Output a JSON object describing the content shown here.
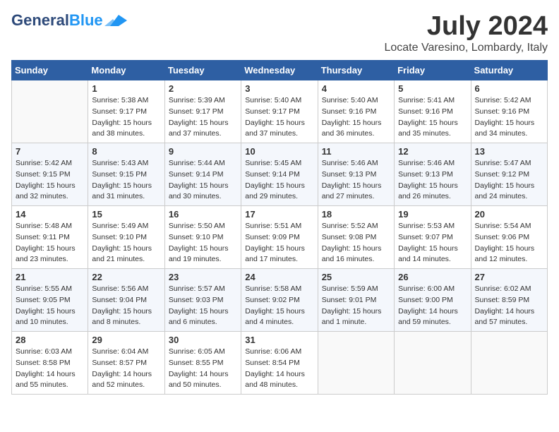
{
  "header": {
    "logo_general": "General",
    "logo_blue": "Blue",
    "month": "July 2024",
    "location": "Locate Varesino, Lombardy, Italy"
  },
  "weekdays": [
    "Sunday",
    "Monday",
    "Tuesday",
    "Wednesday",
    "Thursday",
    "Friday",
    "Saturday"
  ],
  "weeks": [
    [
      {
        "day": "",
        "sunrise": "",
        "sunset": "",
        "daylight": ""
      },
      {
        "day": "1",
        "sunrise": "Sunrise: 5:38 AM",
        "sunset": "Sunset: 9:17 PM",
        "daylight": "Daylight: 15 hours and 38 minutes."
      },
      {
        "day": "2",
        "sunrise": "Sunrise: 5:39 AM",
        "sunset": "Sunset: 9:17 PM",
        "daylight": "Daylight: 15 hours and 37 minutes."
      },
      {
        "day": "3",
        "sunrise": "Sunrise: 5:40 AM",
        "sunset": "Sunset: 9:17 PM",
        "daylight": "Daylight: 15 hours and 37 minutes."
      },
      {
        "day": "4",
        "sunrise": "Sunrise: 5:40 AM",
        "sunset": "Sunset: 9:16 PM",
        "daylight": "Daylight: 15 hours and 36 minutes."
      },
      {
        "day": "5",
        "sunrise": "Sunrise: 5:41 AM",
        "sunset": "Sunset: 9:16 PM",
        "daylight": "Daylight: 15 hours and 35 minutes."
      },
      {
        "day": "6",
        "sunrise": "Sunrise: 5:42 AM",
        "sunset": "Sunset: 9:16 PM",
        "daylight": "Daylight: 15 hours and 34 minutes."
      }
    ],
    [
      {
        "day": "7",
        "sunrise": "Sunrise: 5:42 AM",
        "sunset": "Sunset: 9:15 PM",
        "daylight": "Daylight: 15 hours and 32 minutes."
      },
      {
        "day": "8",
        "sunrise": "Sunrise: 5:43 AM",
        "sunset": "Sunset: 9:15 PM",
        "daylight": "Daylight: 15 hours and 31 minutes."
      },
      {
        "day": "9",
        "sunrise": "Sunrise: 5:44 AM",
        "sunset": "Sunset: 9:14 PM",
        "daylight": "Daylight: 15 hours and 30 minutes."
      },
      {
        "day": "10",
        "sunrise": "Sunrise: 5:45 AM",
        "sunset": "Sunset: 9:14 PM",
        "daylight": "Daylight: 15 hours and 29 minutes."
      },
      {
        "day": "11",
        "sunrise": "Sunrise: 5:46 AM",
        "sunset": "Sunset: 9:13 PM",
        "daylight": "Daylight: 15 hours and 27 minutes."
      },
      {
        "day": "12",
        "sunrise": "Sunrise: 5:46 AM",
        "sunset": "Sunset: 9:13 PM",
        "daylight": "Daylight: 15 hours and 26 minutes."
      },
      {
        "day": "13",
        "sunrise": "Sunrise: 5:47 AM",
        "sunset": "Sunset: 9:12 PM",
        "daylight": "Daylight: 15 hours and 24 minutes."
      }
    ],
    [
      {
        "day": "14",
        "sunrise": "Sunrise: 5:48 AM",
        "sunset": "Sunset: 9:11 PM",
        "daylight": "Daylight: 15 hours and 23 minutes."
      },
      {
        "day": "15",
        "sunrise": "Sunrise: 5:49 AM",
        "sunset": "Sunset: 9:10 PM",
        "daylight": "Daylight: 15 hours and 21 minutes."
      },
      {
        "day": "16",
        "sunrise": "Sunrise: 5:50 AM",
        "sunset": "Sunset: 9:10 PM",
        "daylight": "Daylight: 15 hours and 19 minutes."
      },
      {
        "day": "17",
        "sunrise": "Sunrise: 5:51 AM",
        "sunset": "Sunset: 9:09 PM",
        "daylight": "Daylight: 15 hours and 17 minutes."
      },
      {
        "day": "18",
        "sunrise": "Sunrise: 5:52 AM",
        "sunset": "Sunset: 9:08 PM",
        "daylight": "Daylight: 15 hours and 16 minutes."
      },
      {
        "day": "19",
        "sunrise": "Sunrise: 5:53 AM",
        "sunset": "Sunset: 9:07 PM",
        "daylight": "Daylight: 15 hours and 14 minutes."
      },
      {
        "day": "20",
        "sunrise": "Sunrise: 5:54 AM",
        "sunset": "Sunset: 9:06 PM",
        "daylight": "Daylight: 15 hours and 12 minutes."
      }
    ],
    [
      {
        "day": "21",
        "sunrise": "Sunrise: 5:55 AM",
        "sunset": "Sunset: 9:05 PM",
        "daylight": "Daylight: 15 hours and 10 minutes."
      },
      {
        "day": "22",
        "sunrise": "Sunrise: 5:56 AM",
        "sunset": "Sunset: 9:04 PM",
        "daylight": "Daylight: 15 hours and 8 minutes."
      },
      {
        "day": "23",
        "sunrise": "Sunrise: 5:57 AM",
        "sunset": "Sunset: 9:03 PM",
        "daylight": "Daylight: 15 hours and 6 minutes."
      },
      {
        "day": "24",
        "sunrise": "Sunrise: 5:58 AM",
        "sunset": "Sunset: 9:02 PM",
        "daylight": "Daylight: 15 hours and 4 minutes."
      },
      {
        "day": "25",
        "sunrise": "Sunrise: 5:59 AM",
        "sunset": "Sunset: 9:01 PM",
        "daylight": "Daylight: 15 hours and 1 minute."
      },
      {
        "day": "26",
        "sunrise": "Sunrise: 6:00 AM",
        "sunset": "Sunset: 9:00 PM",
        "daylight": "Daylight: 14 hours and 59 minutes."
      },
      {
        "day": "27",
        "sunrise": "Sunrise: 6:02 AM",
        "sunset": "Sunset: 8:59 PM",
        "daylight": "Daylight: 14 hours and 57 minutes."
      }
    ],
    [
      {
        "day": "28",
        "sunrise": "Sunrise: 6:03 AM",
        "sunset": "Sunset: 8:58 PM",
        "daylight": "Daylight: 14 hours and 55 minutes."
      },
      {
        "day": "29",
        "sunrise": "Sunrise: 6:04 AM",
        "sunset": "Sunset: 8:57 PM",
        "daylight": "Daylight: 14 hours and 52 minutes."
      },
      {
        "day": "30",
        "sunrise": "Sunrise: 6:05 AM",
        "sunset": "Sunset: 8:55 PM",
        "daylight": "Daylight: 14 hours and 50 minutes."
      },
      {
        "day": "31",
        "sunrise": "Sunrise: 6:06 AM",
        "sunset": "Sunset: 8:54 PM",
        "daylight": "Daylight: 14 hours and 48 minutes."
      },
      {
        "day": "",
        "sunrise": "",
        "sunset": "",
        "daylight": ""
      },
      {
        "day": "",
        "sunrise": "",
        "sunset": "",
        "daylight": ""
      },
      {
        "day": "",
        "sunrise": "",
        "sunset": "",
        "daylight": ""
      }
    ]
  ]
}
